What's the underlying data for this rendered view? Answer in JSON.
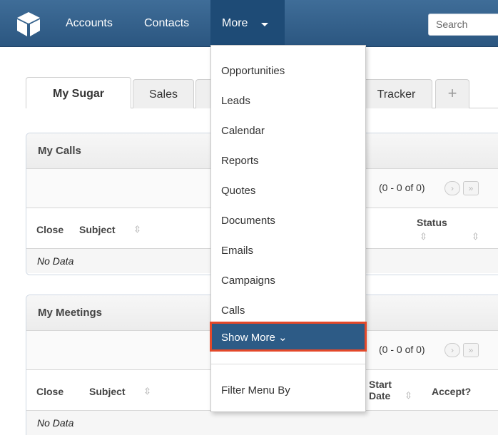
{
  "nav": {
    "items": [
      "Accounts",
      "Contacts"
    ],
    "more_label": "More",
    "search_placeholder": "Search"
  },
  "tabs": [
    "My Sugar",
    "Sales",
    "Tracker"
  ],
  "add_tab_label": "+",
  "dashlets": [
    {
      "title": "My Calls",
      "pager": "(0 - 0 of 0)",
      "columns": [
        "Close",
        "Subject",
        "Status"
      ],
      "row": "No Data"
    },
    {
      "title": "My Meetings",
      "pager": "(0 - 0 of 0)",
      "columns": [
        "Close",
        "Subject",
        "Start Date",
        "Accept?"
      ],
      "row": "No Data"
    }
  ],
  "more_menu": {
    "items": [
      "Opportunities",
      "Leads",
      "Calendar",
      "Reports",
      "Quotes",
      "Documents",
      "Emails",
      "Campaigns",
      "Calls"
    ],
    "show_more": "Show More ⌄",
    "filter": "Filter Menu By"
  },
  "colors": {
    "nav": "#2b5680",
    "highlight": "#2d5b86",
    "highlight_border": "#e4492a"
  }
}
